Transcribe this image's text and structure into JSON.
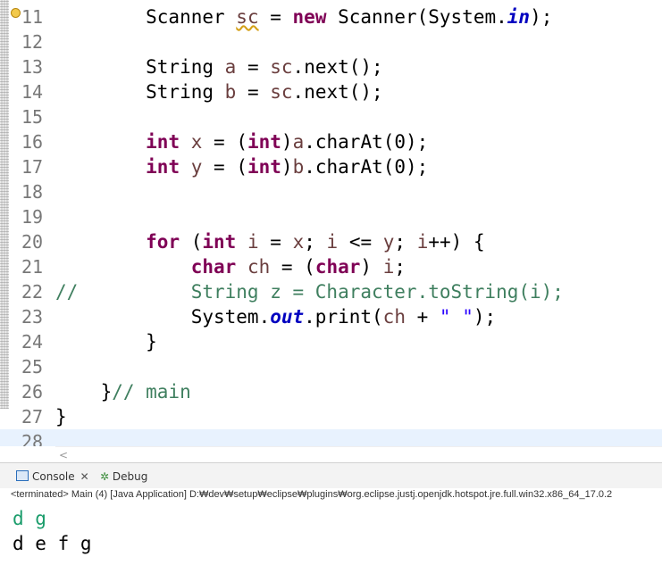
{
  "editor": {
    "lines": [
      {
        "num": "11",
        "segs": [
          {
            "t": "        Scanner ",
            "c": ""
          },
          {
            "t": "sc",
            "c": "var sq"
          },
          {
            "t": " = ",
            "c": ""
          },
          {
            "t": "new",
            "c": "kw"
          },
          {
            "t": " Scanner(System.",
            "c": ""
          },
          {
            "t": "in",
            "c": "fld"
          },
          {
            "t": ");",
            "c": ""
          }
        ]
      },
      {
        "num": "12",
        "segs": []
      },
      {
        "num": "13",
        "segs": [
          {
            "t": "        String ",
            "c": ""
          },
          {
            "t": "a",
            "c": "var"
          },
          {
            "t": " = ",
            "c": ""
          },
          {
            "t": "sc",
            "c": "var"
          },
          {
            "t": ".next();",
            "c": ""
          }
        ]
      },
      {
        "num": "14",
        "segs": [
          {
            "t": "        String ",
            "c": ""
          },
          {
            "t": "b",
            "c": "var"
          },
          {
            "t": " = ",
            "c": ""
          },
          {
            "t": "sc",
            "c": "var"
          },
          {
            "t": ".next();",
            "c": ""
          }
        ]
      },
      {
        "num": "15",
        "segs": []
      },
      {
        "num": "16",
        "segs": [
          {
            "t": "        ",
            "c": ""
          },
          {
            "t": "int",
            "c": "kw"
          },
          {
            "t": " ",
            "c": ""
          },
          {
            "t": "x",
            "c": "var"
          },
          {
            "t": " = (",
            "c": ""
          },
          {
            "t": "int",
            "c": "kw"
          },
          {
            "t": ")",
            "c": ""
          },
          {
            "t": "a",
            "c": "var"
          },
          {
            "t": ".charAt(0);",
            "c": ""
          }
        ]
      },
      {
        "num": "17",
        "segs": [
          {
            "t": "        ",
            "c": ""
          },
          {
            "t": "int",
            "c": "kw"
          },
          {
            "t": " ",
            "c": ""
          },
          {
            "t": "y",
            "c": "var"
          },
          {
            "t": " = (",
            "c": ""
          },
          {
            "t": "int",
            "c": "kw"
          },
          {
            "t": ")",
            "c": ""
          },
          {
            "t": "b",
            "c": "var"
          },
          {
            "t": ".charAt(0);",
            "c": ""
          }
        ]
      },
      {
        "num": "18",
        "segs": []
      },
      {
        "num": "19",
        "segs": []
      },
      {
        "num": "20",
        "segs": [
          {
            "t": "        ",
            "c": ""
          },
          {
            "t": "for",
            "c": "kw"
          },
          {
            "t": " (",
            "c": ""
          },
          {
            "t": "int",
            "c": "kw"
          },
          {
            "t": " ",
            "c": ""
          },
          {
            "t": "i",
            "c": "var"
          },
          {
            "t": " = ",
            "c": ""
          },
          {
            "t": "x",
            "c": "var"
          },
          {
            "t": "; ",
            "c": ""
          },
          {
            "t": "i",
            "c": "var"
          },
          {
            "t": " <= ",
            "c": ""
          },
          {
            "t": "y",
            "c": "var"
          },
          {
            "t": "; ",
            "c": ""
          },
          {
            "t": "i",
            "c": "var"
          },
          {
            "t": "++) {",
            "c": ""
          }
        ]
      },
      {
        "num": "21",
        "segs": [
          {
            "t": "            ",
            "c": ""
          },
          {
            "t": "char",
            "c": "kw"
          },
          {
            "t": " ",
            "c": ""
          },
          {
            "t": "ch",
            "c": "var"
          },
          {
            "t": " = (",
            "c": ""
          },
          {
            "t": "char",
            "c": "kw"
          },
          {
            "t": ") ",
            "c": ""
          },
          {
            "t": "i",
            "c": "var"
          },
          {
            "t": ";",
            "c": ""
          }
        ]
      },
      {
        "num": "22",
        "segs": [
          {
            "t": "//          String z = Character.toString(i);",
            "c": "cm"
          }
        ]
      },
      {
        "num": "23",
        "segs": [
          {
            "t": "            System.",
            "c": ""
          },
          {
            "t": "out",
            "c": "fld"
          },
          {
            "t": ".print(",
            "c": ""
          },
          {
            "t": "ch",
            "c": "var"
          },
          {
            "t": " + ",
            "c": ""
          },
          {
            "t": "\" \"",
            "c": "st"
          },
          {
            "t": ");",
            "c": ""
          }
        ]
      },
      {
        "num": "24",
        "segs": [
          {
            "t": "        }",
            "c": ""
          }
        ]
      },
      {
        "num": "25",
        "segs": []
      },
      {
        "num": "26",
        "segs": [
          {
            "t": "    }",
            "c": ""
          },
          {
            "t": "// main",
            "c": "cm"
          }
        ]
      },
      {
        "num": "27",
        "segs": [
          {
            "t": "}",
            "c": ""
          }
        ]
      },
      {
        "num": "28",
        "segs": []
      }
    ]
  },
  "console": {
    "tab_console": "Console",
    "tab_debug": "Debug",
    "status": "<terminated> Main (4) [Java Application] D:₩dev₩setup₩eclipse₩plugins₩org.eclipse.justj.openjdk.hotspot.jre.full.win32.x86_64_17.0.2",
    "input_line": "d g",
    "output_line": "d e f g"
  },
  "colors": {
    "keyword": "#7f0055",
    "variable": "#6a3e3e",
    "comment": "#3f7f5f",
    "string": "#2a00ff",
    "field": "#0000c0",
    "console_input": "#1a9c6b",
    "current_line": "#e8f2fe"
  },
  "icons": {
    "console_tab": "console-icon",
    "debug_tab": "bug-icon",
    "warning": "warning-icon"
  }
}
